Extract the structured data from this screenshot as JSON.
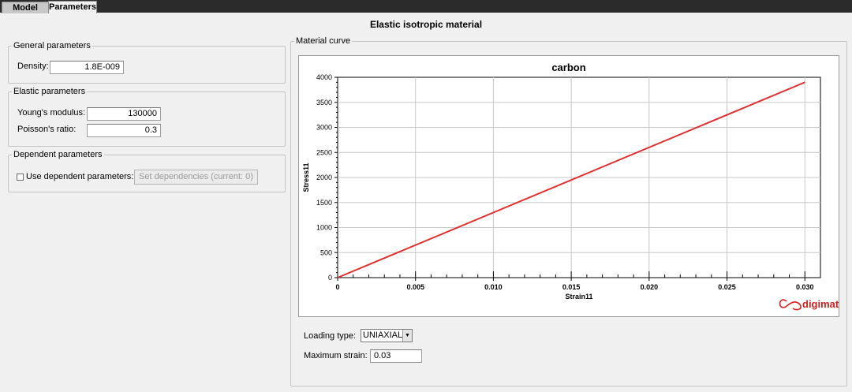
{
  "tabs": [
    {
      "label": "Model",
      "active": false
    },
    {
      "label": "Parameters",
      "active": true
    }
  ],
  "page_title": "Elastic isotropic material",
  "general": {
    "legend": "General parameters",
    "density_label": "Density:",
    "density_value": "1.8E-009"
  },
  "elastic": {
    "legend": "Elastic parameters",
    "youngs_label": "Young's modulus:",
    "youngs_value": "130000",
    "poisson_label": "Poisson's ratio:",
    "poisson_value": "0.3"
  },
  "dependent": {
    "legend": "Dependent parameters",
    "checkbox_label": "Use dependent parameters:",
    "checked": false,
    "button_label": "Set dependencies (current: 0)"
  },
  "material_curve": {
    "legend": "Material curve",
    "logo_text": "digimat",
    "loading_type_label": "Loading type:",
    "loading_type_value": "UNIAXIAL_",
    "max_strain_label": "Maximum strain:",
    "max_strain_value": "0.03"
  },
  "chart_data": {
    "type": "line",
    "title": "carbon",
    "xlabel": "Strain11",
    "ylabel": "Stress11",
    "xlim": [
      0,
      0.031
    ],
    "ylim": [
      0,
      4000
    ],
    "x_ticks": [
      "0",
      "0.005",
      "0.010",
      "0.015",
      "0.020",
      "0.025",
      "0.030"
    ],
    "x_tick_values": [
      0,
      0.005,
      0.01,
      0.015,
      0.02,
      0.025,
      0.03
    ],
    "y_ticks": [
      "0",
      "500",
      "1000",
      "1500",
      "2000",
      "2500",
      "3000",
      "3500",
      "4000"
    ],
    "y_tick_values": [
      0,
      500,
      1000,
      1500,
      2000,
      2500,
      3000,
      3500,
      4000
    ],
    "grid": true,
    "line_color": "#e03030",
    "series": [
      {
        "x": [
          0,
          0.03
        ],
        "y": [
          0,
          3900
        ]
      }
    ]
  }
}
